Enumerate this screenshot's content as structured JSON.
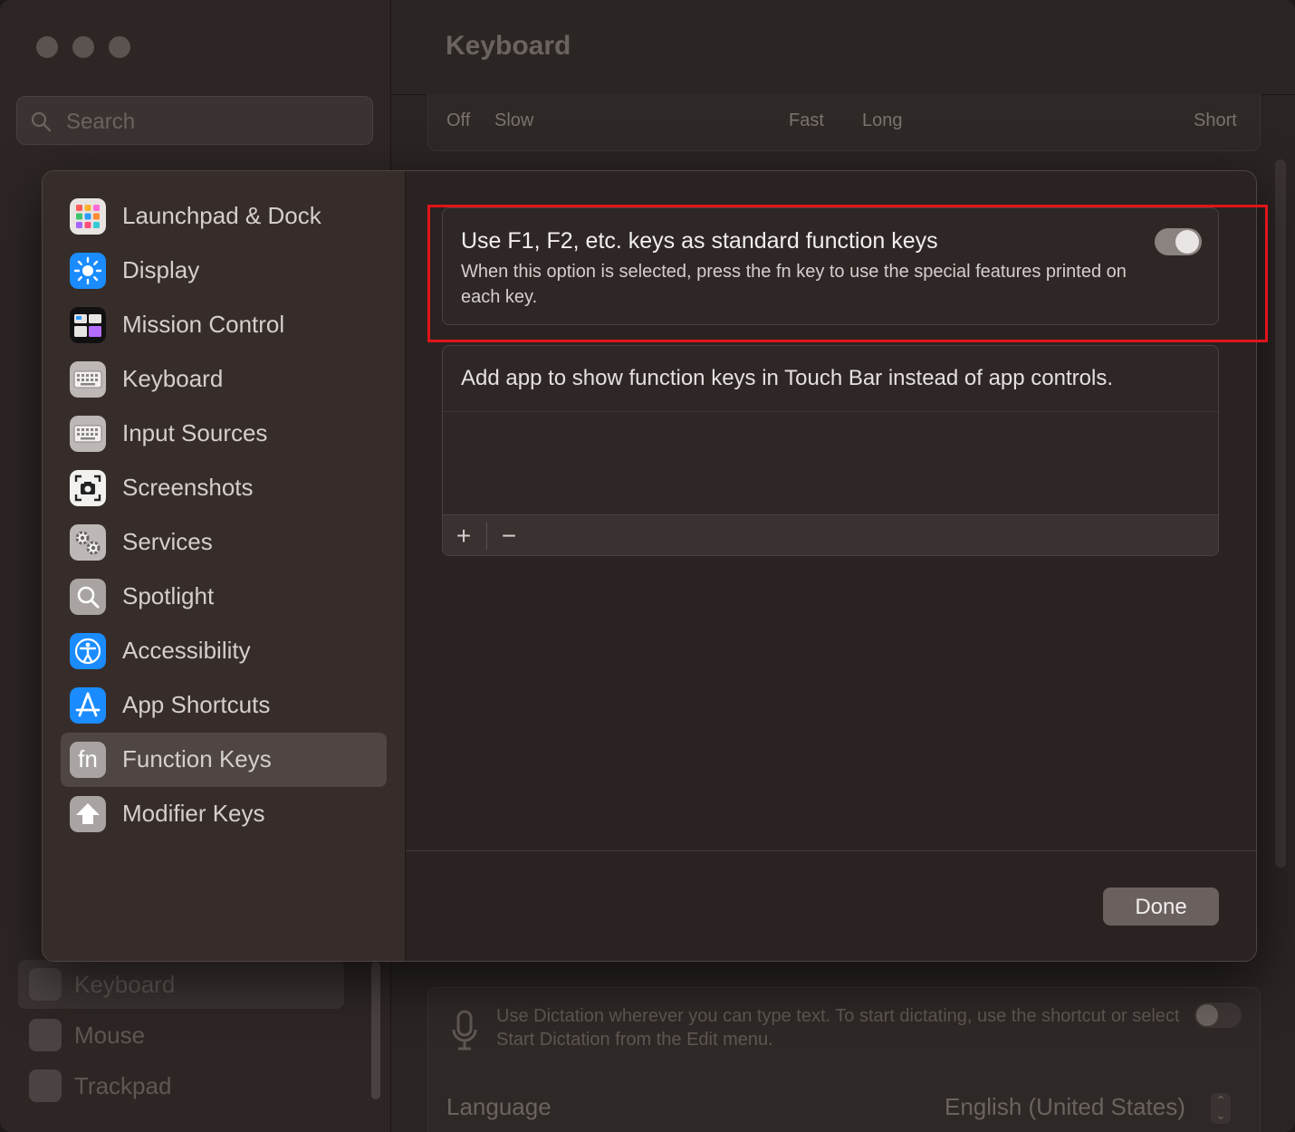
{
  "window": {
    "title": "Keyboard",
    "search_placeholder": "Search"
  },
  "background_slider_labels": {
    "off": "Off",
    "slow": "Slow",
    "fast": "Fast",
    "long": "Long",
    "short": "Short"
  },
  "background_sidebar": {
    "items": [
      {
        "label": "Keyboard"
      },
      {
        "label": "Mouse"
      },
      {
        "label": "Trackpad"
      }
    ]
  },
  "background_dictation": {
    "description": "Use Dictation wherever you can type text. To start dictating, use the shortcut or select Start Dictation from the Edit menu.",
    "language_label": "Language",
    "language_value": "English (United States)",
    "enabled": false
  },
  "sheet": {
    "nav": [
      {
        "label": "Launchpad & Dock",
        "icon": "launchpad-icon"
      },
      {
        "label": "Display",
        "icon": "display-icon"
      },
      {
        "label": "Mission Control",
        "icon": "mission-control-icon"
      },
      {
        "label": "Keyboard",
        "icon": "keyboard-icon"
      },
      {
        "label": "Input Sources",
        "icon": "input-sources-icon"
      },
      {
        "label": "Screenshots",
        "icon": "screenshots-icon"
      },
      {
        "label": "Services",
        "icon": "services-icon"
      },
      {
        "label": "Spotlight",
        "icon": "spotlight-icon"
      },
      {
        "label": "Accessibility",
        "icon": "accessibility-icon"
      },
      {
        "label": "App Shortcuts",
        "icon": "app-shortcuts-icon"
      },
      {
        "label": "Function Keys",
        "icon": "fn-icon",
        "selected": true
      },
      {
        "label": "Modifier Keys",
        "icon": "modifier-keys-icon"
      }
    ],
    "fn_option": {
      "title": "Use F1, F2, etc. keys as standard function keys",
      "description": "When this option is selected, press the fn key to use the special features printed on each key.",
      "enabled": true
    },
    "touchbar_apps": {
      "title": "Add app to show function keys in Touch Bar instead of app controls.",
      "add": "+",
      "remove": "−"
    },
    "done_label": "Done",
    "fn_icon_text": "fn"
  },
  "colors": {
    "highlight": "#e0141b",
    "accent_blue": "#1a8cff"
  }
}
